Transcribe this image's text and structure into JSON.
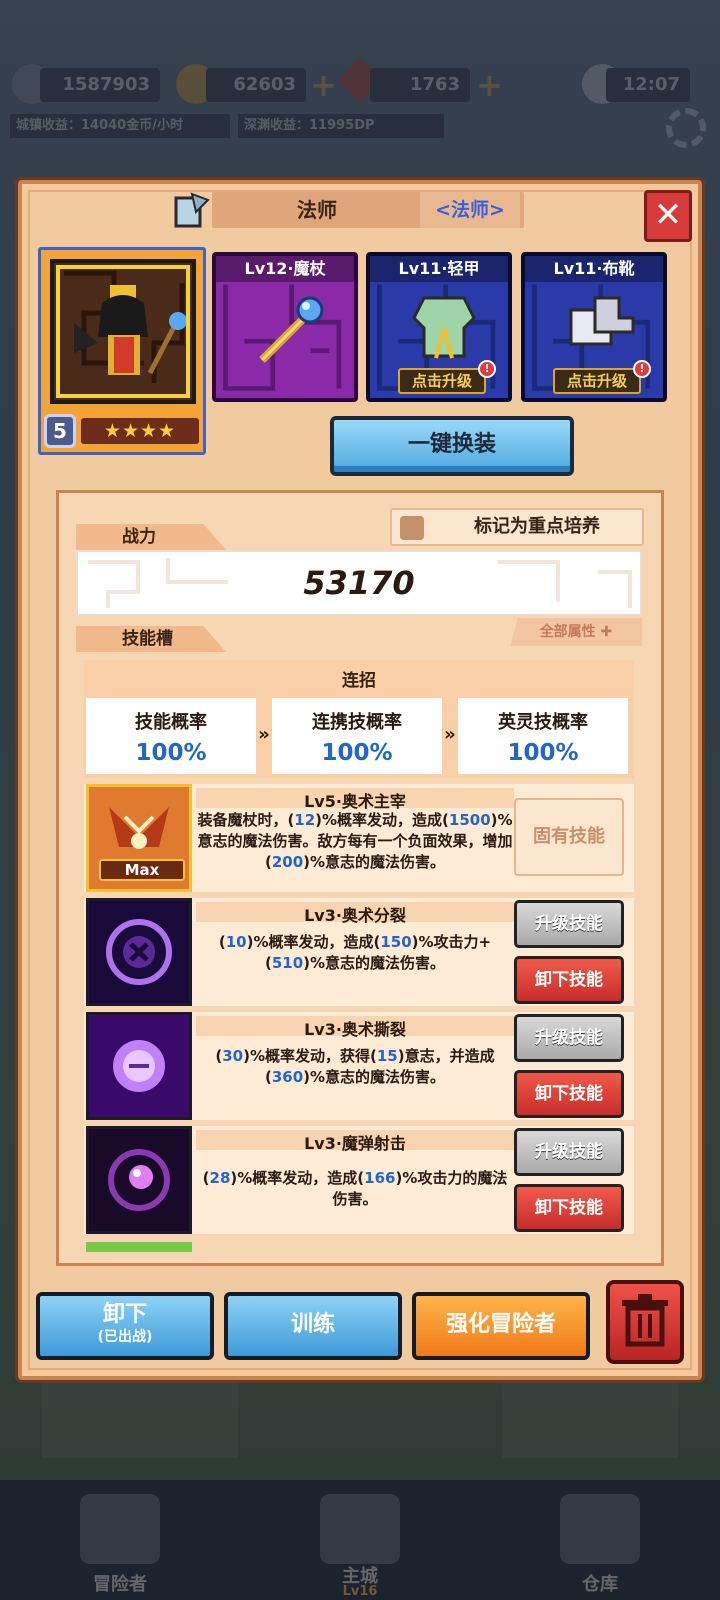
{
  "topbar": {
    "trophy": "1587903",
    "gold": "62603",
    "gems": "1763",
    "time": "12:07",
    "city_income": "城镇收益：14040金币/小时",
    "abyss_income": "深渊收益：11995DP"
  },
  "nav": {
    "adventurer": "冒险者",
    "main_city": "主城",
    "main_city_level": "Lv16",
    "warehouse": "仓库"
  },
  "panel": {
    "class_name": "法师",
    "class_tag": "<法师>",
    "close_icon": "✕"
  },
  "hero": {
    "level": "5",
    "stars": "★★★★"
  },
  "equipment": [
    {
      "label": "Lv12·魔杖",
      "action": ""
    },
    {
      "label": "Lv11·轻甲",
      "action": "点击升级"
    },
    {
      "label": "Lv11·布靴",
      "action": "点击升级"
    }
  ],
  "one_key_equip": "一键换装",
  "stats": {
    "power_label": "战力",
    "mark_label": "标记为重点培养",
    "power_value": "53170",
    "skill_slot_label": "技能槽",
    "all_attributes": "全部属性 ✚"
  },
  "combo": {
    "title": "连招",
    "items": [
      {
        "label": "技能概率",
        "value": "100%"
      },
      {
        "label": "连携技概率",
        "value": "100%"
      },
      {
        "label": "英灵技概率",
        "value": "100%"
      }
    ],
    "chevron": "»"
  },
  "skills": [
    {
      "name": "Lv5·奥术主宰",
      "desc": [
        "装备魔杖时，(",
        "12",
        ")%概率发动，造成(",
        "1500",
        ")%意志的魔法伤害。敌方每有一个负面效果，增加(",
        "200",
        ")%意志的魔法伤害。"
      ],
      "max": "Max",
      "inherent": "固有技能"
    },
    {
      "name": "Lv3·奥术分裂",
      "desc": [
        "(",
        "10",
        ")%概率发动，造成(",
        "150",
        ")%攻击力+(",
        "510",
        ")%意志的魔法伤害。"
      ],
      "upgrade": "升级技能",
      "remove": "卸下技能"
    },
    {
      "name": "Lv3·奥术撕裂",
      "desc": [
        "(",
        "30",
        ")%概率发动，获得(",
        "15",
        ")意志，并造成(",
        "360",
        ")%意志的魔法伤害。"
      ],
      "upgrade": "升级技能",
      "remove": "卸下技能"
    },
    {
      "name": "Lv3·魔弹射击",
      "desc": [
        "(",
        "28",
        ")%概率发动，造成(",
        "166",
        ")%攻击力的魔法伤害。"
      ],
      "upgrade": "升级技能",
      "remove": "卸下技能"
    }
  ],
  "actions": {
    "unequip": "卸下",
    "unequip_sub": "(已出战)",
    "train": "训练",
    "enhance": "强化冒险者"
  }
}
